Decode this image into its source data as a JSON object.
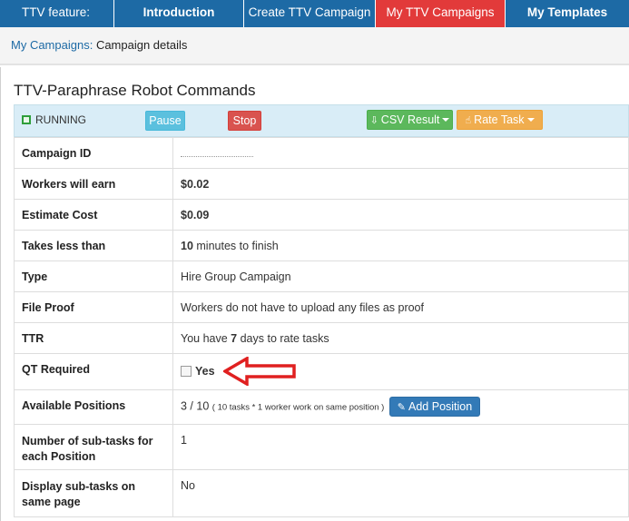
{
  "nav": {
    "feature_label": "TTV feature:",
    "introduction": "Introduction",
    "create_campaign": "Create TTV Campaign",
    "my_campaigns": "My TTV Campaigns",
    "my_templates": "My Templates"
  },
  "breadcrumb": {
    "link": "My Campaigns:",
    "current": "Campaign details"
  },
  "campaign": {
    "title": "TTV-Paraphrase Robot Commands",
    "status": "RUNNING",
    "pause_label": "Pause",
    "stop_label": "Stop",
    "csv_label": "CSV Result",
    "rate_label": "Rate Task"
  },
  "details": {
    "campaign_id_label": "Campaign ID",
    "workers_earn_label": "Workers will earn",
    "workers_earn_value": "$0.02",
    "estimate_cost_label": "Estimate Cost",
    "estimate_cost_value": "$0.09",
    "takes_label": "Takes less than",
    "takes_num": "10",
    "takes_text": "minutes to finish",
    "type_label": "Type",
    "type_value": "Hire Group Campaign",
    "file_proof_label": "File Proof",
    "file_proof_value": "Workers do not have to upload any files as proof",
    "ttr_label": "TTR",
    "ttr_prefix": "You have",
    "ttr_num": "7",
    "ttr_suffix": "days to rate tasks",
    "qt_label": "QT Required",
    "qt_option": "Yes",
    "positions_label": "Available Positions",
    "positions_value": "3 / 10",
    "positions_note": "( 10 tasks * 1 worker work on same position )",
    "add_position_label": "Add Position",
    "subtasks_label": "Number of sub-tasks for each Position",
    "subtasks_value": "1",
    "display_label": "Display sub-tasks on same page",
    "display_value": "No"
  },
  "colors": {
    "nav_blue": "#1d6aa5",
    "nav_active_red": "#e23a3a",
    "status_bg": "#d9edf7",
    "annotation_arrow": "#e02020"
  }
}
